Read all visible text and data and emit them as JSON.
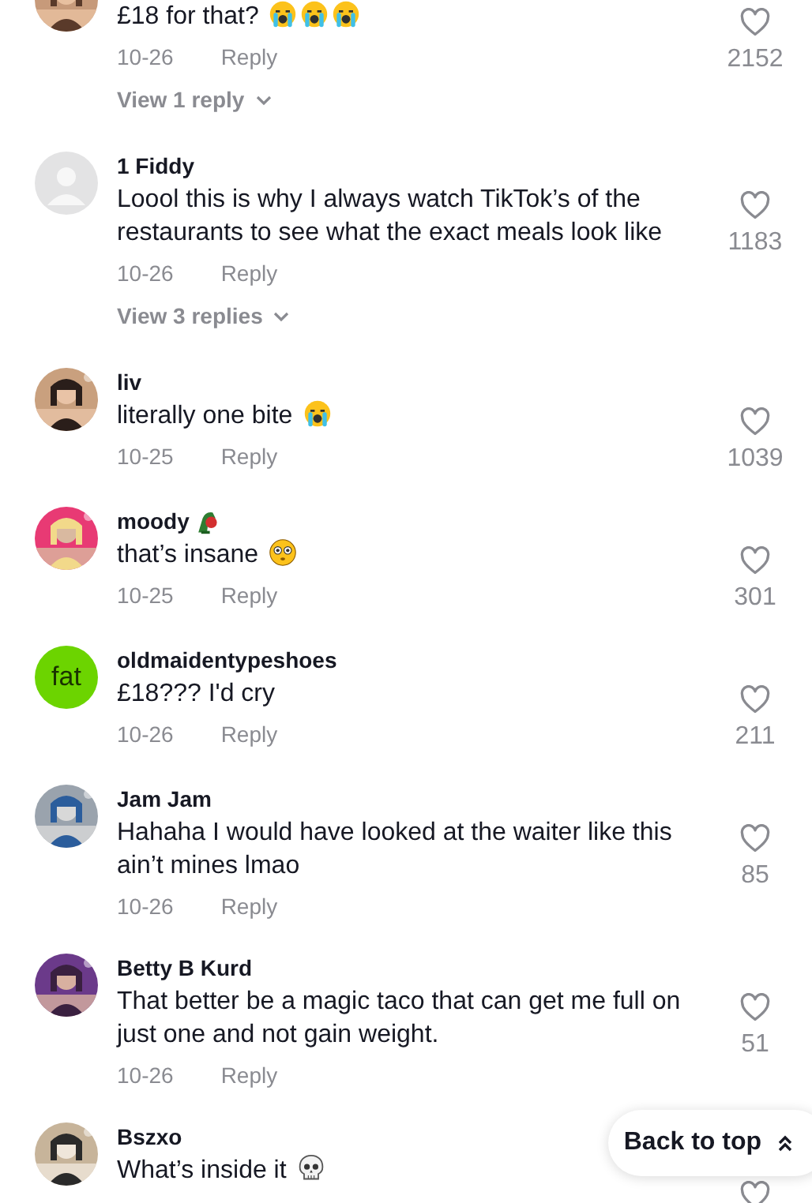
{
  "comments": [
    {
      "text": "£18 for that?",
      "emojis": [
        {
          "kind": "crying"
        },
        {
          "kind": "crying"
        },
        {
          "kind": "crying"
        }
      ],
      "date": "10-26",
      "reply": "Reply",
      "likes": "2152",
      "liked": false,
      "view_replies": "View 1 reply"
    },
    {
      "username": "1 Fiddy",
      "avatar": {
        "kind": "default"
      },
      "text": "Loool this is why I always watch TikTok’s of the restaurants to see what the exact meals look like",
      "date": "10-26",
      "reply": "Reply",
      "likes": "1183",
      "liked": false,
      "view_replies": "View 3 replies"
    },
    {
      "username": "liv",
      "text": "literally one bite",
      "emojis": [
        {
          "kind": "crying"
        }
      ],
      "date": "10-25",
      "reply": "Reply",
      "likes": "1039",
      "liked": false
    },
    {
      "username": "moody",
      "username_emojis": [
        {
          "kind": "plant"
        }
      ],
      "text": "that’s insane",
      "emojis": [
        {
          "kind": "flushed"
        }
      ],
      "date": "10-25",
      "reply": "Reply",
      "likes": "301",
      "liked": false
    },
    {
      "username": "oldmaidentypeshoes",
      "avatar": {
        "kind": "text",
        "text": "fat",
        "color": "#6cd400"
      },
      "text": "£18??? I'd cry",
      "date": "10-26",
      "reply": "Reply",
      "likes": "211",
      "liked": false
    },
    {
      "username": "Jam Jam",
      "text": "Hahaha I would have looked at the waiter like this ain’t mines lmao",
      "date": "10-26",
      "reply": "Reply",
      "likes": "85",
      "liked": false
    },
    {
      "username": "Betty B Kurd",
      "text": "That better be a magic taco that can get me full on just one and not gain weight.",
      "date": "10-26",
      "reply": "Reply",
      "likes": "51",
      "liked": false
    },
    {
      "username": "Bszxo",
      "text": "What’s inside it",
      "emojis": [
        {
          "kind": "skull"
        }
      ],
      "liked": false
    }
  ],
  "back_to_top": {
    "label": "Back to top"
  }
}
